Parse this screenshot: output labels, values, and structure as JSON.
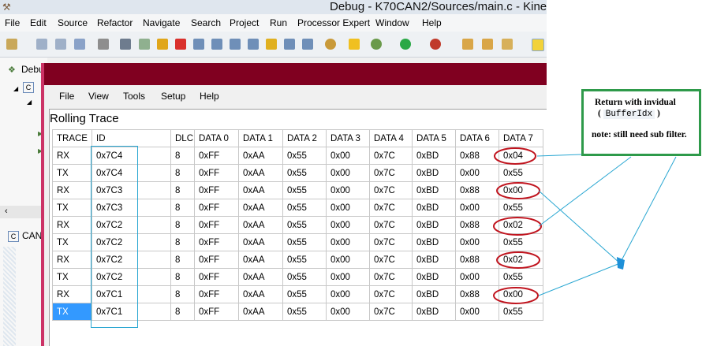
{
  "window": {
    "title": "Debug - K70CAN2/Sources/main.c - Kine",
    "menu": [
      "File",
      "Edit",
      "Source",
      "Refactor",
      "Navigate",
      "Search",
      "Project",
      "Run",
      "Processor Expert",
      "Window",
      "Help"
    ]
  },
  "left_pane": {
    "debug_tab": "Debu",
    "can_tab": "CAN"
  },
  "trace_window": {
    "menu": [
      "File",
      "View",
      "Tools",
      "Setup",
      "Help"
    ],
    "panel_title": "Rolling Trace",
    "columns": [
      "TRACE",
      "ID",
      "DLC",
      "DATA 0",
      "DATA 1",
      "DATA 2",
      "DATA 3",
      "DATA 4",
      "DATA 5",
      "DATA 6",
      "DATA 7"
    ],
    "rows": [
      [
        "RX",
        "0x7C4",
        "8",
        "0xFF",
        "0xAA",
        "0x55",
        "0x00",
        "0x7C",
        "0xBD",
        "0x88",
        "0x04"
      ],
      [
        "TX",
        "0x7C4",
        "8",
        "0xFF",
        "0xAA",
        "0x55",
        "0x00",
        "0x7C",
        "0xBD",
        "0x00",
        "0x55"
      ],
      [
        "RX",
        "0x7C3",
        "8",
        "0xFF",
        "0xAA",
        "0x55",
        "0x00",
        "0x7C",
        "0xBD",
        "0x88",
        "0x00"
      ],
      [
        "TX",
        "0x7C3",
        "8",
        "0xFF",
        "0xAA",
        "0x55",
        "0x00",
        "0x7C",
        "0xBD",
        "0x00",
        "0x55"
      ],
      [
        "RX",
        "0x7C2",
        "8",
        "0xFF",
        "0xAA",
        "0x55",
        "0x00",
        "0x7C",
        "0xBD",
        "0x88",
        "0x02"
      ],
      [
        "TX",
        "0x7C2",
        "8",
        "0xFF",
        "0xAA",
        "0x55",
        "0x00",
        "0x7C",
        "0xBD",
        "0x00",
        "0x55"
      ],
      [
        "RX",
        "0x7C2",
        "8",
        "0xFF",
        "0xAA",
        "0x55",
        "0x00",
        "0x7C",
        "0xBD",
        "0x88",
        "0x02"
      ],
      [
        "TX",
        "0x7C2",
        "8",
        "0xFF",
        "0xAA",
        "0x55",
        "0x00",
        "0x7C",
        "0xBD",
        "0x00",
        "0x55"
      ],
      [
        "RX",
        "0x7C1",
        "8",
        "0xFF",
        "0xAA",
        "0x55",
        "0x00",
        "0x7C",
        "0xBD",
        "0x88",
        "0x00"
      ],
      [
        "TX",
        "0x7C1",
        "8",
        "0xFF",
        "0xAA",
        "0x55",
        "0x00",
        "0x7C",
        "0xBD",
        "0x00",
        "0x55"
      ]
    ],
    "selected_row": 9
  },
  "callout": {
    "line1": "Return with invidual",
    "open_paren": "(",
    "code": "BufferIdx",
    "close_paren": ")",
    "note": "note: still need sub filter."
  },
  "colors": {
    "trace_title_bar": "#800020",
    "oval": "#c0141e",
    "callout_border": "#2e9a4a",
    "arrow": "#2aa7d2",
    "selection": "#3399ff"
  }
}
